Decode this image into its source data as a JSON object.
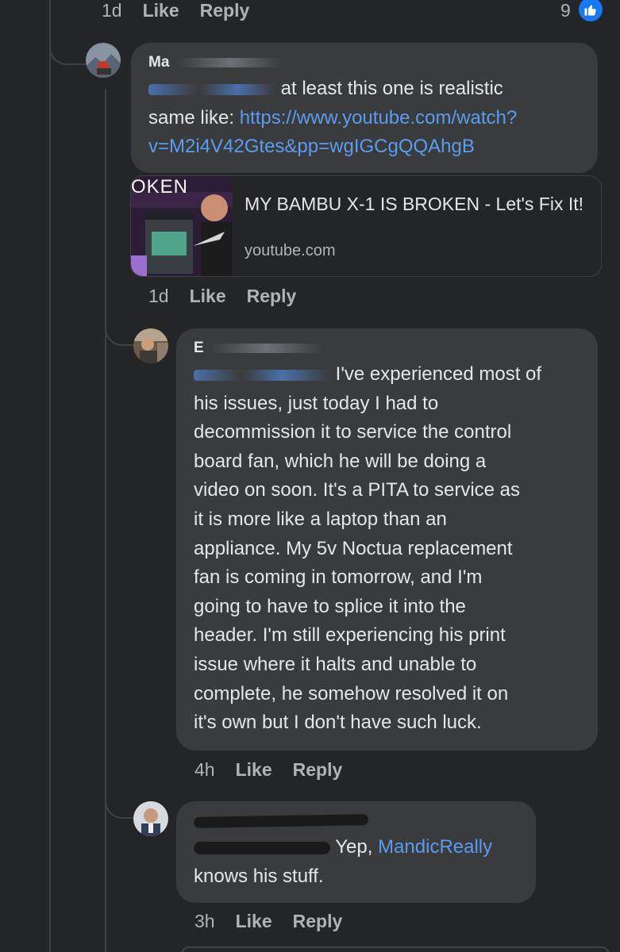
{
  "top_actions": {
    "time": "1d",
    "like": "Like",
    "reply": "Reply",
    "reaction_count": "9"
  },
  "comment1": {
    "author": "Ma",
    "mention": "",
    "text_1": " at least this one is realistic",
    "text_2": "same like: ",
    "link_1": "https://www.youtube.com/watch?",
    "link_2": "v=M2i4V42Gtes&pp=wgIGCgQQAhgB",
    "time": "1d",
    "like": "Like",
    "reply": "Reply"
  },
  "link_preview": {
    "thumb_text": "OKEN",
    "title": "MY BAMBU X-1 IS BROKEN - Let's Fix It!",
    "domain": "youtube.com"
  },
  "comment2": {
    "author": "E",
    "lines": [
      " I've experienced most of",
      "his issues, just today I had to",
      "decommission it to service the control",
      "board fan, which he will be doing a",
      "video on soon. It's a PITA to service as",
      "it is more like a laptop than an",
      "appliance. My 5v Noctua replacement",
      "fan is coming in tomorrow, and I'm",
      "going to have to splice it into the",
      "header. I'm still experiencing his print",
      "issue where it halts and unable to",
      "complete, he somehow resolved it on",
      "it's own but I don't have such luck."
    ],
    "time": "4h",
    "like": "Like",
    "reply": "Reply"
  },
  "comment3": {
    "text_1": "Yep, ",
    "mention": "MandicReally",
    "text_2": "knows his stuff.",
    "time": "3h",
    "like": "Like",
    "reply": "Reply"
  },
  "colors": {
    "background": "#242526",
    "bubble": "#3a3b3c",
    "link": "#5b9bf0",
    "like_blue": "#1877f2"
  }
}
